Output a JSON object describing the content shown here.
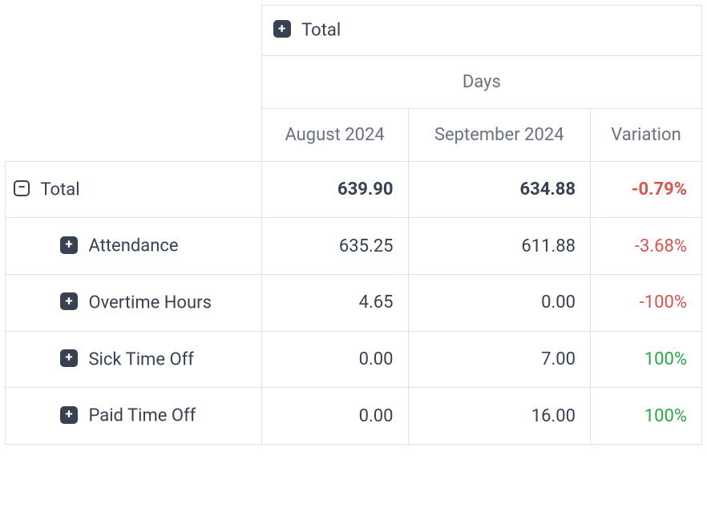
{
  "table": {
    "top_header_label": "Total",
    "group_header": "Days",
    "columns": [
      "August 2024",
      "September 2024",
      "Variation"
    ],
    "total_row_label": "Total",
    "rows": [
      {
        "label": "Total",
        "aug": "639.90",
        "sep": "634.88",
        "variation": "-0.79%",
        "variation_sign": "neg",
        "is_total": true
      },
      {
        "label": "Attendance",
        "aug": "635.25",
        "sep": "611.88",
        "variation": "-3.68%",
        "variation_sign": "neg",
        "is_total": false
      },
      {
        "label": "Overtime Hours",
        "aug": "4.65",
        "sep": "0.00",
        "variation": "-100%",
        "variation_sign": "neg",
        "is_total": false
      },
      {
        "label": "Sick Time Off",
        "aug": "0.00",
        "sep": "7.00",
        "variation": "100%",
        "variation_sign": "pos",
        "is_total": false
      },
      {
        "label": "Paid Time Off",
        "aug": "0.00",
        "sep": "16.00",
        "variation": "100%",
        "variation_sign": "pos",
        "is_total": false
      }
    ]
  }
}
